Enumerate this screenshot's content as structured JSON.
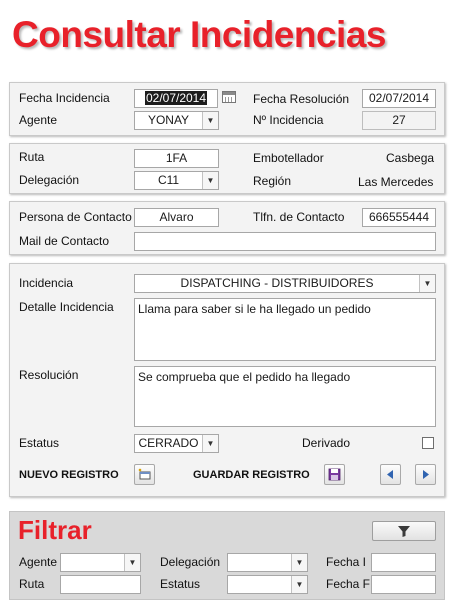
{
  "title": "Consultar Incidencias",
  "section1": {
    "fecha_incidencia_label": "Fecha Incidencia",
    "fecha_incidencia_value": "02/07/2014",
    "fecha_resolucion_label": "Fecha Resolución",
    "fecha_resolucion_value": "02/07/2014",
    "agente_label": "Agente",
    "agente_value": "YONAY",
    "num_incidencia_label": "Nº Incidencia",
    "num_incidencia_value": "27"
  },
  "section2": {
    "ruta_label": "Ruta",
    "ruta_value": "1FA",
    "embotellador_label": "Embotellador",
    "embotellador_value": "Casbega",
    "delegacion_label": "Delegación",
    "delegacion_value": "C11",
    "region_label": "Región",
    "region_value": "Las Mercedes"
  },
  "section3": {
    "persona_label": "Persona de Contacto",
    "persona_value": "Alvaro",
    "tlfn_label": "Tlfn. de Contacto",
    "tlfn_value": "666555444",
    "mail_label": "Mail de Contacto",
    "mail_value": ""
  },
  "section4": {
    "incidencia_label": "Incidencia",
    "incidencia_value": "DISPATCHING - DISTRIBUIDORES",
    "detalle_label": "Detalle Incidencia",
    "detalle_value": "Llama para saber si le ha llegado un pedido",
    "resolucion_label": "Resolución",
    "resolucion_value": "Se comprueba que el pedido ha llegado",
    "estatus_label": "Estatus",
    "estatus_value": "CERRADO",
    "derivado_label": "Derivado",
    "derivado_checked": false,
    "nuevo_label": "NUEVO REGISTRO",
    "guardar_label": "GUARDAR REGISTRO"
  },
  "filter": {
    "title": "Filtrar",
    "agente_label": "Agente",
    "delegacion_label": "Delegación",
    "fecha_i_label": "Fecha I",
    "ruta_label": "Ruta",
    "estatus_label": "Estatus",
    "fecha_f_label": "Fecha F"
  },
  "icons": {
    "calendar": "calendar-icon",
    "dropdown": "chevron-down-icon",
    "new": "new-record-icon",
    "save": "save-icon",
    "prev": "triangle-left-icon",
    "next": "triangle-right-icon",
    "filter": "funnel-icon"
  },
  "colors": {
    "title_red": "#e8212a",
    "nav_blue": "#2f63b0",
    "save_purple": "#7a3aa0"
  }
}
